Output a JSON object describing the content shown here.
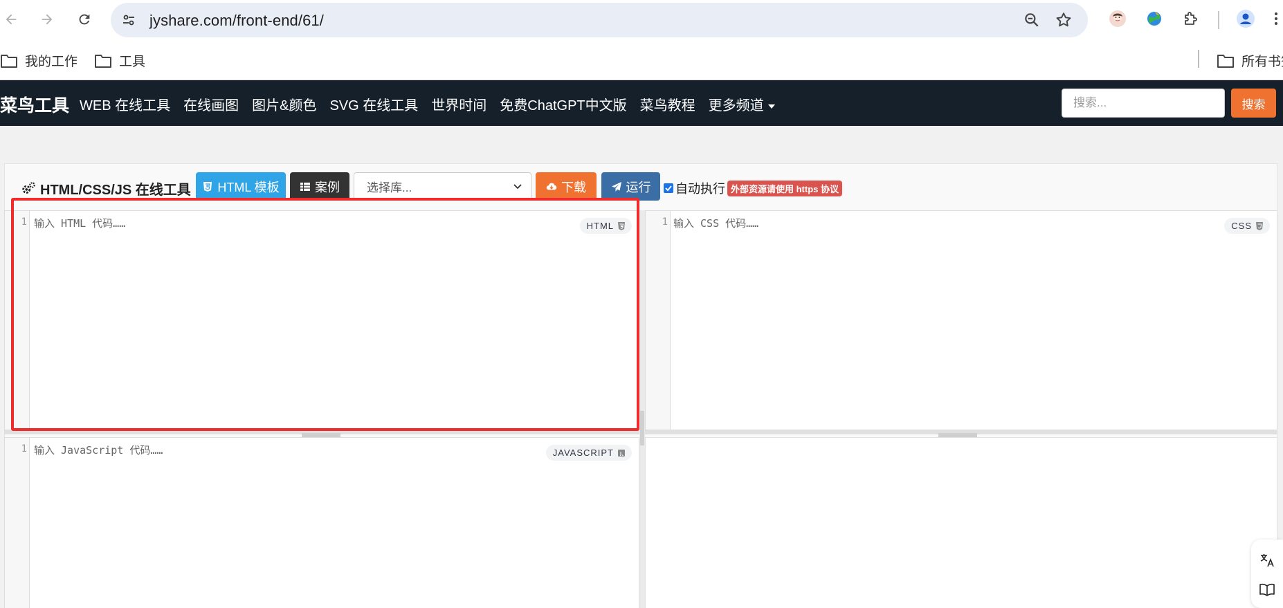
{
  "browser": {
    "url": "jyshare.com/front-end/61/",
    "bookmarks": [
      "我的工作",
      "工具"
    ],
    "all_bookmarks_label": "所有书签"
  },
  "site": {
    "brand": "菜鸟工具",
    "nav": [
      "WEB 在线工具",
      "在线画图",
      "图片&颜色",
      "SVG 在线工具",
      "世界时间",
      "免费ChatGPT中文版",
      "菜鸟教程",
      "更多频道"
    ],
    "search_placeholder": "搜索...",
    "search_button": "搜索"
  },
  "toolbar": {
    "title": "HTML/CSS/JS 在线工具",
    "html_template": "HTML 模板",
    "case": "案例",
    "library_placeholder": "选择库...",
    "download": "下载",
    "run": "运行",
    "auto_run": "自动执行",
    "https_notice": "外部资源请使用 https 协议"
  },
  "editors": {
    "html": {
      "line": "1",
      "placeholder": "输入 HTML 代码……",
      "tag": "HTML"
    },
    "css": {
      "line": "1",
      "placeholder": "输入 CSS 代码……",
      "tag": "CSS"
    },
    "js": {
      "line": "1",
      "placeholder": "输入 JavaScript 代码……",
      "tag": "JAVASCRIPT"
    }
  },
  "colors": {
    "nav_bg": "#15202b",
    "accent_orange": "#ef7231",
    "accent_blue": "#2fa4e7",
    "run_blue": "#3b6ea5",
    "highlight_red": "#ef2b2b"
  }
}
